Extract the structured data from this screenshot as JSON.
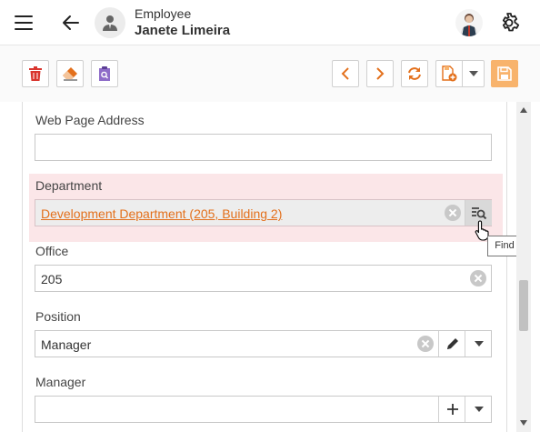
{
  "header": {
    "object_type": "Employee",
    "employee_name": "Janete Limeira"
  },
  "toolbar": {
    "icons": [
      "delete-icon",
      "clear-icon",
      "find-record-icon",
      "previous-icon",
      "next-icon",
      "refresh-icon",
      "save-new-icon",
      "dropdown-icon",
      "save-icon"
    ],
    "accent": "#e3701c"
  },
  "form": {
    "web_page": {
      "label": "Web Page Address",
      "value": ""
    },
    "department": {
      "label": "Department",
      "value": "Development Department (205, Building 2)"
    },
    "office": {
      "label": "Office",
      "value": "205"
    },
    "position": {
      "label": "Position",
      "value": "Manager"
    },
    "manager": {
      "label": "Manager",
      "value": ""
    }
  },
  "tooltip": {
    "text": "Find"
  },
  "colors": {
    "invalid_bg": "#fbe6e8",
    "link": "#e3701c",
    "save_button": "#f8b36c"
  }
}
